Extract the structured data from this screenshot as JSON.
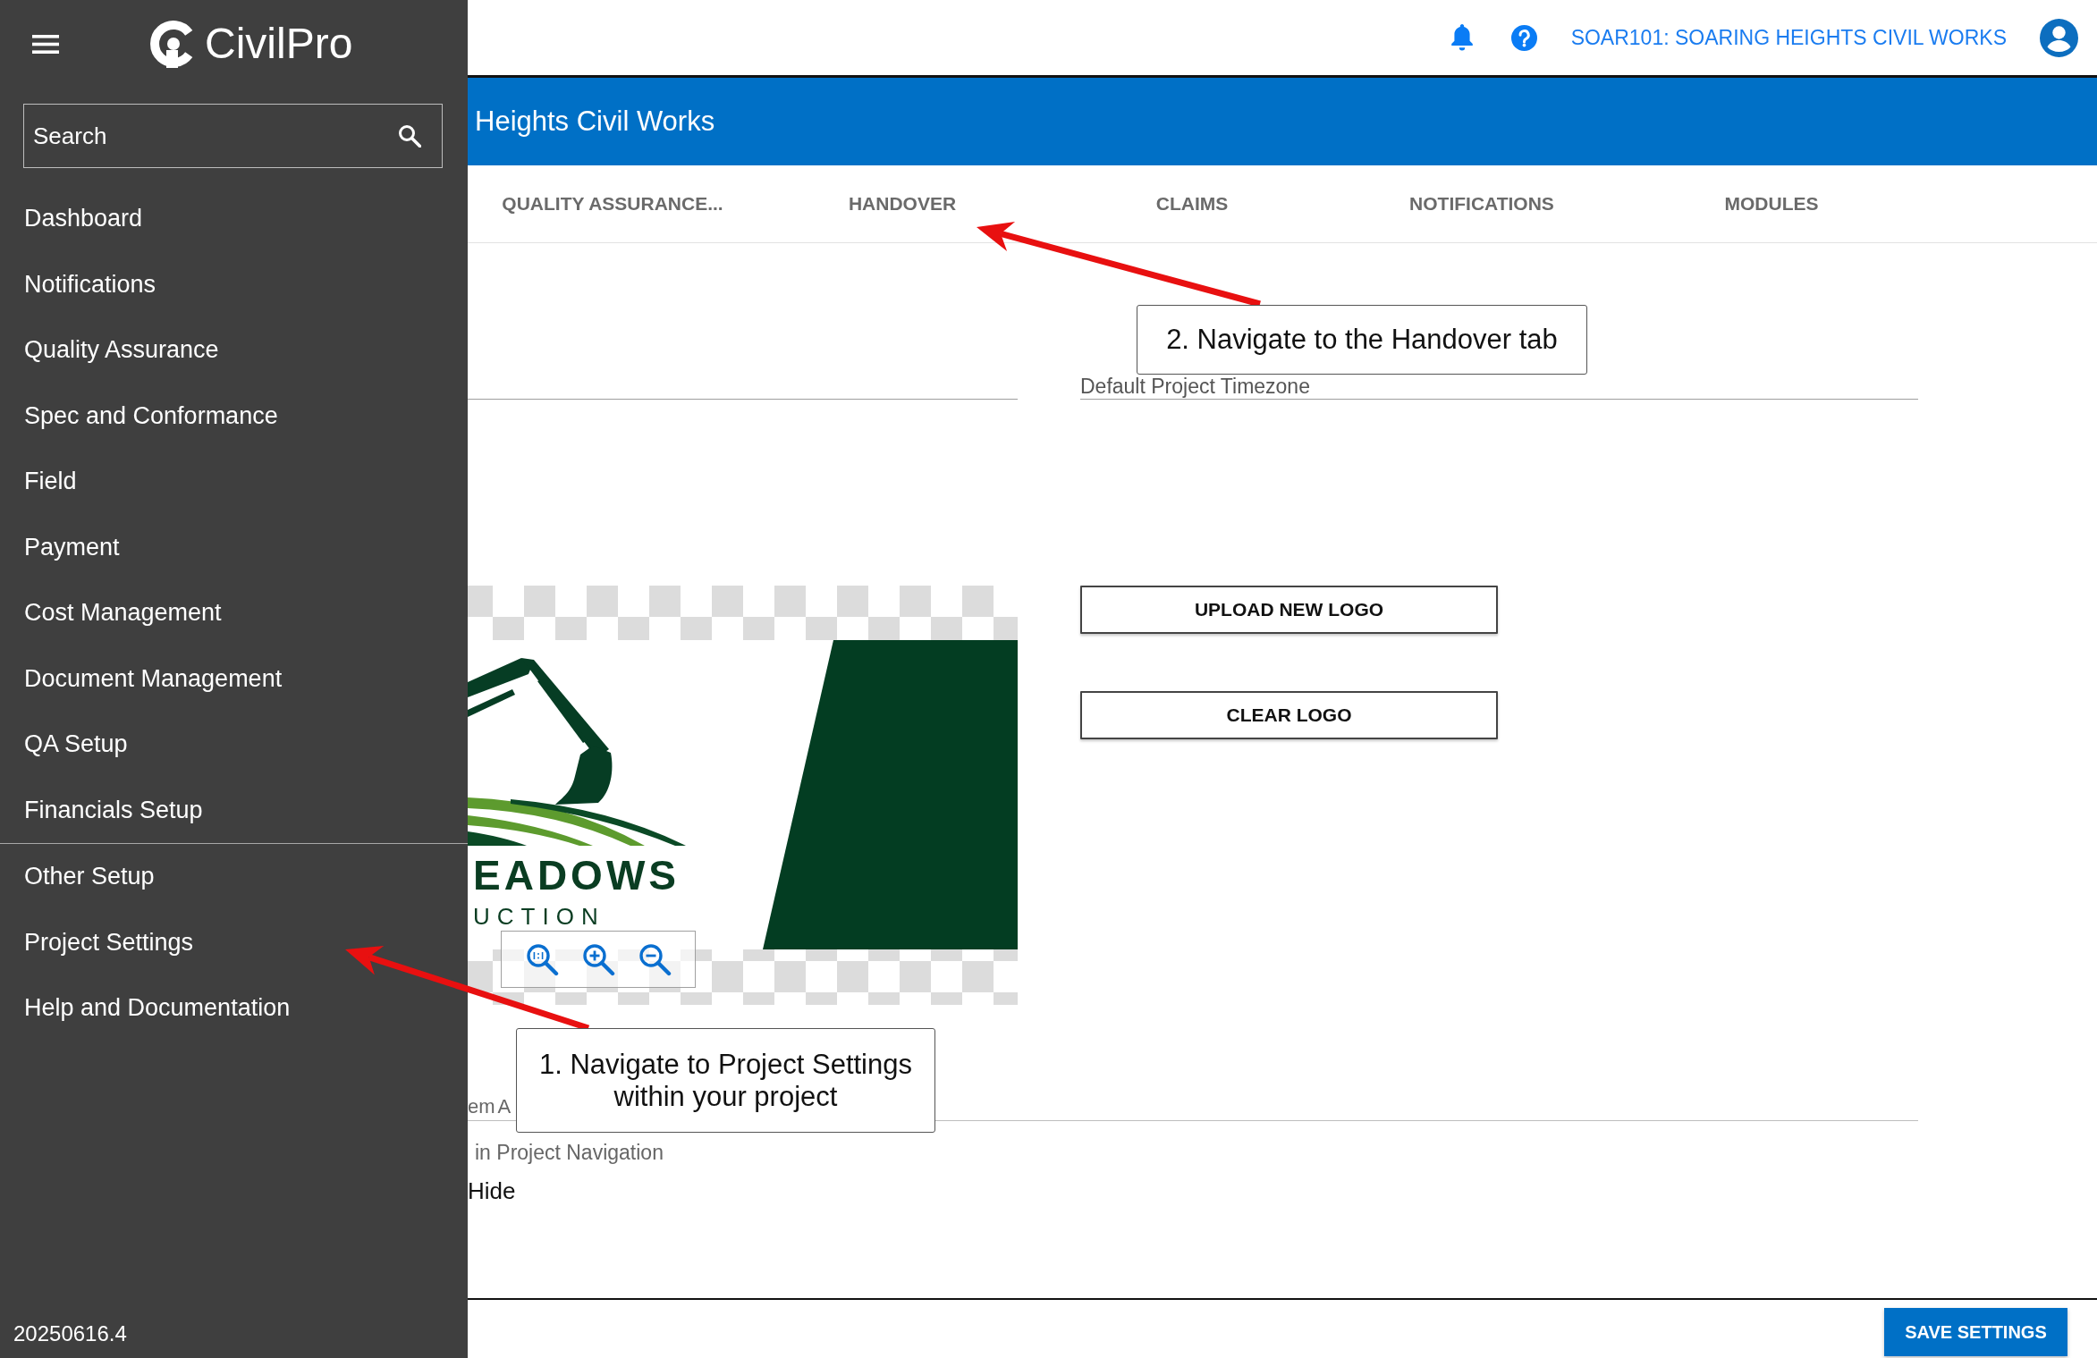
{
  "sidebar": {
    "brand": "CivilPro",
    "search": {
      "placeholder": "Search"
    },
    "groups": [
      {
        "items": [
          {
            "label": "Dashboard"
          },
          {
            "label": "Notifications"
          },
          {
            "label": "Quality Assurance"
          },
          {
            "label": "Spec and Conformance"
          },
          {
            "label": "Field"
          },
          {
            "label": "Payment"
          },
          {
            "label": "Cost Management"
          },
          {
            "label": "Document Management"
          },
          {
            "label": "QA Setup"
          },
          {
            "label": "Financials Setup"
          }
        ]
      },
      {
        "items": [
          {
            "label": "Other Setup"
          },
          {
            "label": "Project Settings"
          },
          {
            "label": "Help and Documentation"
          }
        ]
      }
    ],
    "version": "20250616.4"
  },
  "top_bar": {
    "project": "SOAR101: SOARING HEIGHTS CIVIL WORKS"
  },
  "header": {
    "title": "Heights Civil Works"
  },
  "tabs": [
    {
      "label": "QUALITY ASSURANCE..."
    },
    {
      "label": "HANDOVER"
    },
    {
      "label": "CLAIMS"
    },
    {
      "label": "NOTIFICATIONS"
    },
    {
      "label": "MODULES"
    }
  ],
  "settings": {
    "timezone_field": {
      "label": "Default Project Timezone"
    },
    "logo_preview": {
      "texts": [
        "EADOWS",
        "UCTION"
      ]
    },
    "logo_buttons": [
      {
        "label": "UPLOAD NEW LOGO"
      },
      {
        "label": "CLEAR LOGO"
      }
    ],
    "field_3": {
      "label": "em A"
    },
    "navigation_setting": {
      "label": "in Project Navigation",
      "option": "Hide"
    }
  },
  "footer": {
    "save_button": "SAVE SETTINGS"
  },
  "callouts": [
    {
      "text": "2. Navigate to the Handover tab"
    },
    {
      "text": "1. Navigate to Project Settings within your project"
    }
  ]
}
